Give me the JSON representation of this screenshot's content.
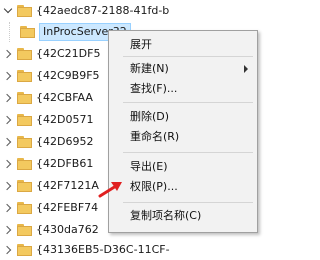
{
  "tree": {
    "items": [
      {
        "label": "{42aedc87-2188-41fd-b",
        "expanded": true
      },
      {
        "label": "InProcServer32",
        "selected": true
      },
      {
        "label": "{42C21DF5"
      },
      {
        "label": "{42C9B9F5"
      },
      {
        "label": "{42CBFAA"
      },
      {
        "label": "{42D0571"
      },
      {
        "label": "{42D6952"
      },
      {
        "label": "{42DFB61"
      },
      {
        "label": "{42F7121A"
      },
      {
        "label": "{42FEBF74"
      },
      {
        "label": "{430da762"
      },
      {
        "label": "{43136EB5-D36C-11CF-"
      }
    ]
  },
  "context_menu": {
    "items": [
      {
        "label": "展开"
      },
      {
        "label": "新建(N)",
        "has_submenu": true
      },
      {
        "label": "查找(F)..."
      },
      {
        "label": "删除(D)"
      },
      {
        "label": "重命名(R)"
      },
      {
        "label": "导出(E)"
      },
      {
        "label": "权限(P)..."
      },
      {
        "label": "复制项名称(C)"
      }
    ]
  },
  "annotation": {
    "icon": "red-arrow-icon",
    "color": "#e02020"
  },
  "colors": {
    "selection_bg": "#cce8ff",
    "selection_border": "#99d1ff",
    "folder": "#f3c95f",
    "menu_bg": "#f2f2f2"
  }
}
